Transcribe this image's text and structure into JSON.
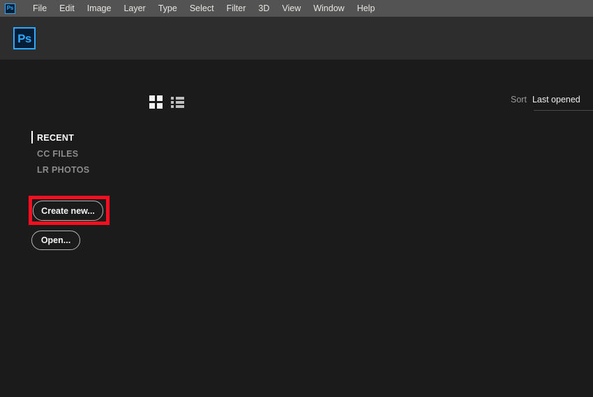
{
  "app": {
    "name": "Adobe Photoshop",
    "logo_text": "Ps",
    "logo_icon": "photoshop-logo-icon",
    "accent_color": "#31a8ff",
    "menubar_bg": "#535353",
    "header_bg": "#2d2d2d",
    "content_bg": "#1b1b1b"
  },
  "menubar": {
    "items": [
      {
        "label": "File"
      },
      {
        "label": "Edit"
      },
      {
        "label": "Image"
      },
      {
        "label": "Layer"
      },
      {
        "label": "Type"
      },
      {
        "label": "Select"
      },
      {
        "label": "Filter"
      },
      {
        "label": "3D"
      },
      {
        "label": "View"
      },
      {
        "label": "Window"
      },
      {
        "label": "Help"
      }
    ]
  },
  "toolbar": {
    "view_grid_icon": "grid-view-icon",
    "view_list_icon": "list-view-icon",
    "sort_label": "Sort",
    "sort_value": "Last opened"
  },
  "sidebar": {
    "items": [
      {
        "label": "RECENT",
        "active": true
      },
      {
        "label": "CC FILES",
        "active": false
      },
      {
        "label": "LR PHOTOS",
        "active": false
      }
    ]
  },
  "actions": {
    "create_new_label": "Create new...",
    "open_label": "Open..."
  },
  "annotation": {
    "target": "create-new-button",
    "color": "#fa0f20"
  }
}
